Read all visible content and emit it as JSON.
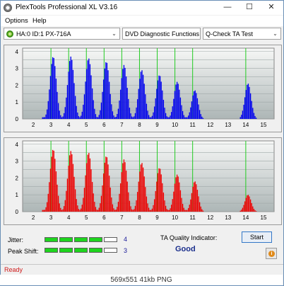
{
  "window": {
    "title": "PlexTools Professional XL V3.16"
  },
  "window_controls": {
    "minimize": "—",
    "maximize": "☐",
    "close": "✕"
  },
  "menu": {
    "options": "Options",
    "help": "Help"
  },
  "toolbar": {
    "drive": "HA:0 ID:1  PX-716A",
    "function": "DVD Diagnostic Functions",
    "test": "Q-Check TA Test",
    "dropdown_arrow": "⌄"
  },
  "chart_data": [
    {
      "type": "bar",
      "name": "lands",
      "color": "#0000ee",
      "x_ticks": [
        "2",
        "3",
        "4",
        "5",
        "6",
        "7",
        "8",
        "9",
        "10",
        "11",
        "12",
        "13",
        "14",
        "15"
      ],
      "y_ticks": [
        "0",
        "0.5",
        "1",
        "1.5",
        "2",
        "2.5",
        "3",
        "3.5",
        "4"
      ],
      "xlim": [
        1.4,
        15.6
      ],
      "ylim": [
        0,
        4.2
      ],
      "peaks": [
        {
          "x": 3.1,
          "y": 3.7
        },
        {
          "x": 4.1,
          "y": 3.7
        },
        {
          "x": 5.1,
          "y": 3.6
        },
        {
          "x": 6.1,
          "y": 3.4
        },
        {
          "x": 7.1,
          "y": 3.2
        },
        {
          "x": 8.1,
          "y": 2.9
        },
        {
          "x": 9.1,
          "y": 2.6
        },
        {
          "x": 10.1,
          "y": 2.2
        },
        {
          "x": 11.1,
          "y": 1.7
        },
        {
          "x": 14.1,
          "y": 2.1
        }
      ],
      "base_start": 2.5,
      "base_end": 11.5,
      "green_lines": [
        3,
        4,
        5,
        6,
        7,
        8,
        9,
        10,
        11,
        14
      ]
    },
    {
      "type": "bar",
      "name": "pits",
      "color": "#ee0000",
      "x_ticks": [
        "2",
        "3",
        "4",
        "5",
        "6",
        "7",
        "8",
        "9",
        "10",
        "11",
        "12",
        "13",
        "14",
        "15"
      ],
      "y_ticks": [
        "0",
        "0.5",
        "1",
        "1.5",
        "2",
        "2.5",
        "3",
        "3.5",
        "4"
      ],
      "xlim": [
        1.4,
        15.6
      ],
      "ylim": [
        0,
        4.2
      ],
      "peaks": [
        {
          "x": 3.1,
          "y": 3.7
        },
        {
          "x": 4.1,
          "y": 3.6
        },
        {
          "x": 5.1,
          "y": 3.5
        },
        {
          "x": 6.1,
          "y": 3.3
        },
        {
          "x": 7.1,
          "y": 3.1
        },
        {
          "x": 8.1,
          "y": 2.9
        },
        {
          "x": 9.1,
          "y": 2.6
        },
        {
          "x": 10.1,
          "y": 2.2
        },
        {
          "x": 11.1,
          "y": 1.8
        },
        {
          "x": 14.1,
          "y": 1.0
        }
      ],
      "base_start": 2.5,
      "base_end": 11.5,
      "green_lines": [
        3,
        4,
        5,
        6,
        7,
        8,
        9,
        10,
        11,
        14
      ]
    }
  ],
  "jitter": {
    "label": "Jitter:",
    "value": "4",
    "level": 4,
    "max": 5
  },
  "peak_shift": {
    "label": "Peak Shift:",
    "value": "3",
    "level": 4,
    "max": 5
  },
  "ta_quality": {
    "label": "TA Quality Indicator:",
    "value": "Good"
  },
  "buttons": {
    "start": "Start",
    "info": "i"
  },
  "status": {
    "text": "Ready"
  },
  "caption": {
    "text": "569x551  41kb  PNG"
  }
}
